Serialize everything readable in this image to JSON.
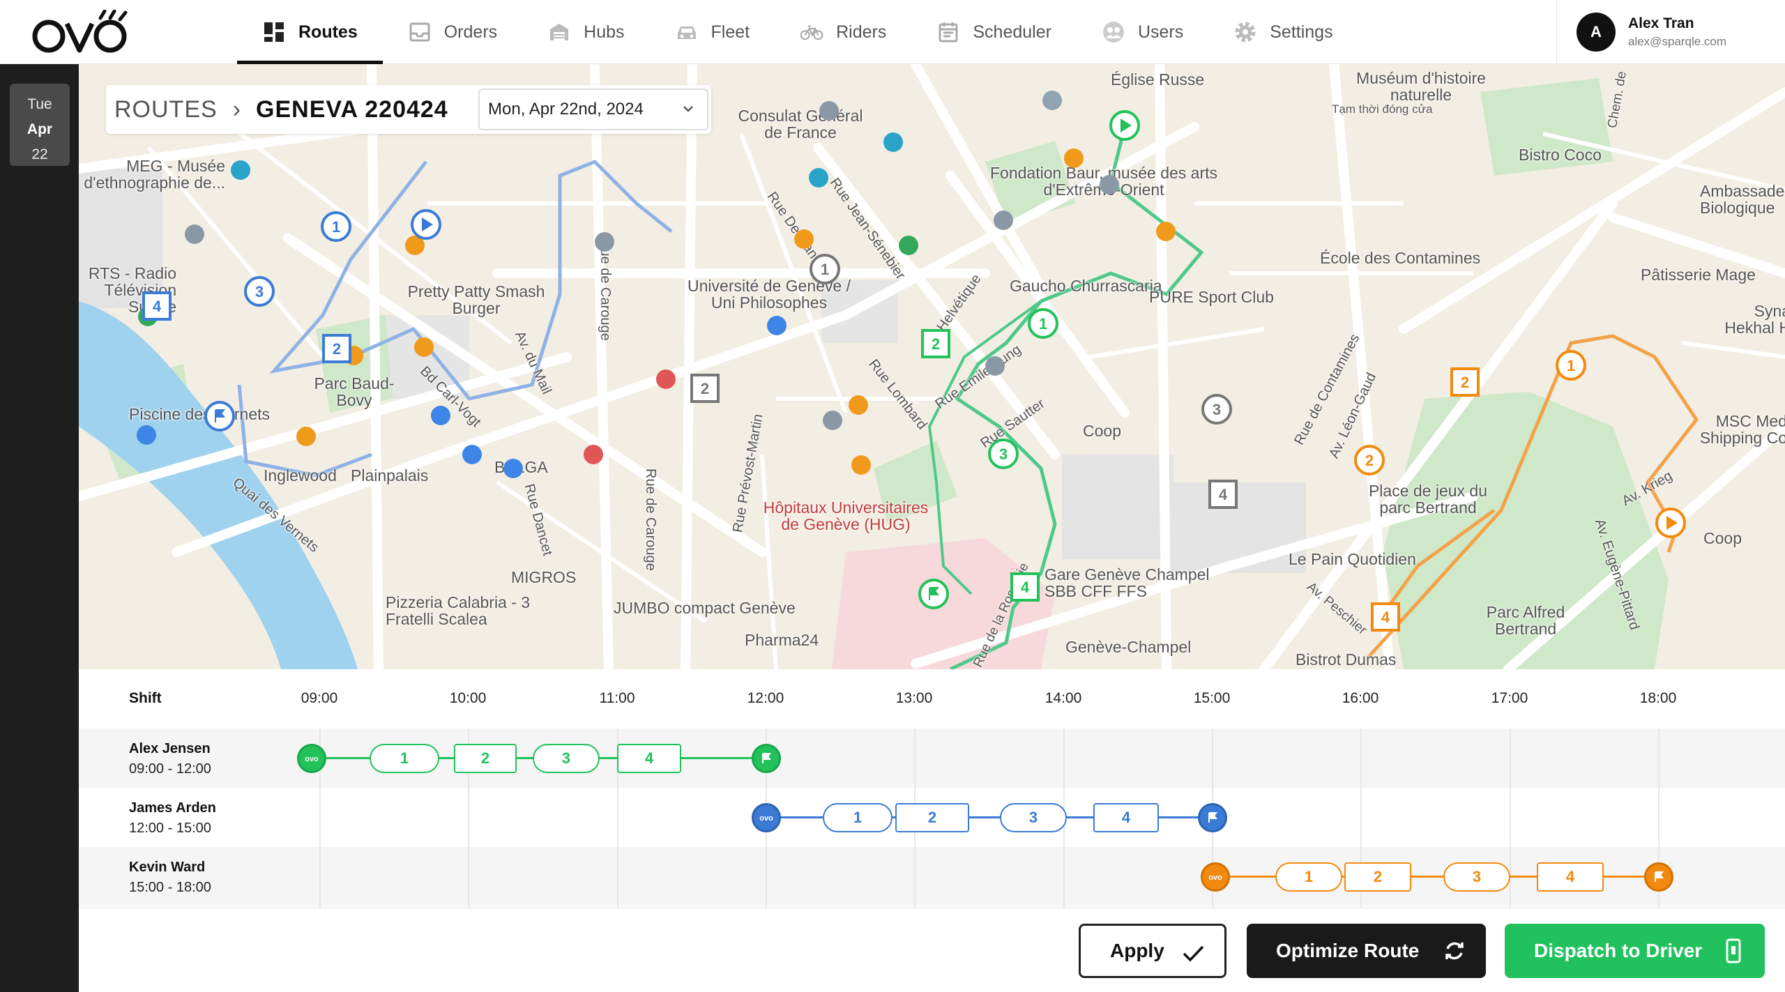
{
  "brand": {
    "logo_text": "ovo"
  },
  "nav": [
    {
      "label": "Routes",
      "icon": "grid-icon",
      "active": true
    },
    {
      "label": "Orders",
      "icon": "inbox-icon"
    },
    {
      "label": "Hubs",
      "icon": "warehouse-icon"
    },
    {
      "label": "Fleet",
      "icon": "car-icon"
    },
    {
      "label": "Riders",
      "icon": "bicycle-icon"
    },
    {
      "label": "Scheduler",
      "icon": "calendar-icon"
    },
    {
      "label": "Users",
      "icon": "users-icon"
    },
    {
      "label": "Settings",
      "icon": "gear-icon"
    }
  ],
  "user": {
    "initial": "A",
    "name": "Alex Tran",
    "email": "alex@sparqle.com"
  },
  "rail": {
    "day": "Tue",
    "month": "Apr",
    "date": "22"
  },
  "breadcrumb": {
    "root": "ROUTES",
    "current": "GENEVA 220424",
    "date_value": "Mon, Apr 22nd, 2024"
  },
  "map_labels": {
    "eglise_russe": "Église Russe",
    "museum": "Muséum d'histoire naturelle",
    "museum_note": "Tạm thời đóng cửa",
    "bistro_coco": "Bistro Coco",
    "ambassade": "Ambassade Biologique",
    "consulat": "Consulat Général de France",
    "meg": "MEG - Musée d'ethnographie de...",
    "fondation": "Fondation Baur, musée des arts d'Extrême-Orient",
    "ecole": "École des Contamines",
    "patisserie": "Pâtisserie Mage",
    "rts": "RTS - Radio Télévision Suisse",
    "pretty_patty": "Pretty Patty Smash Burger",
    "universite": "Université de Genève / Uni Philosophes",
    "gaucho": "Gaucho Churrascaria",
    "pure": "PURE Sport Club",
    "syna": "Syna Hekhal H",
    "parc_baud": "Parc Baud-Bovy",
    "piscine": "Piscine des Vernets",
    "coop1": "Coop",
    "msc": "MSC Med Shipping Co",
    "inglewood": "Inglewood",
    "plainpalais": "Plainpalais",
    "belga": "BELGA",
    "place_jeux": "Place de jeux du parc Bertrand",
    "hug": "Hôpitaux Universitaires de Genève (HUG)",
    "coop2": "Coop",
    "le_pain": "Le Pain Quotidien",
    "migros": "MIGROS",
    "gare": "Gare Genève Champel SBB CFF FFS",
    "pizzeria": "Pizzeria Calabria - 3 Fratelli Scalea",
    "jumbo": "JUMBO compact Genève",
    "parc_alfred": "Parc Alfred Bertrand",
    "pharma": "Pharma24",
    "geneve_champel": "Genève-Champel",
    "bistrot": "Bistrot Dumas",
    "rue_carouge": "Rue de Carouge",
    "rue_carouge2": "Rue de Carouge",
    "bd_carl_vogt": "Bd Carl-Vogt",
    "av_mail": "Av. du Mail",
    "rue_candolle": "Rue De-Candolle",
    "rue_senebier": "Rue Jean-Sénebier",
    "bd_helvetique": "Bd Helvétique",
    "rue_lombard": "Rue Lombard",
    "rue_emile": "Rue Emile-Yung",
    "rue_sautter": "Rue Sautter",
    "rue_contamines": "Rue de Contamines",
    "av_leon": "Av. Léon-Gaud",
    "av_krieg": "Av. Krieg",
    "av_pictet": "Av. Eugène-Pittard",
    "quai_vernets": "Quai des Vernets",
    "rue_dancet": "Rue Dancet",
    "rue_prevost": "Rue Prévost-Martin",
    "rue_roseraie": "Rue de la Roseraie",
    "chem": "Chem. de",
    "av_peschier": "Av. Peschier"
  },
  "schedule": {
    "shift_header": "Shift",
    "ticks": [
      "09:00",
      "10:00",
      "11:00",
      "12:00",
      "13:00",
      "14:00",
      "15:00",
      "16:00",
      "17:00",
      "18:00"
    ],
    "drivers": [
      {
        "name": "Alex Jensen",
        "time": "09:00 - 12:00",
        "color": "#22c25a",
        "stops": [
          "1",
          "2",
          "3",
          "4"
        ]
      },
      {
        "name": "James Arden",
        "time": "12:00 - 15:00",
        "color": "#3b7bd6",
        "stops": [
          "1",
          "2",
          "3",
          "4"
        ]
      },
      {
        "name": "Kevin Ward",
        "time": "15:00 - 18:00",
        "color": "#f28a0f",
        "stops": [
          "1",
          "2",
          "3",
          "4"
        ]
      }
    ]
  },
  "actions": {
    "apply": "Apply",
    "optimize": "Optimize Route",
    "dispatch": "Dispatch to Driver"
  },
  "colors": {
    "green": "#22c25a",
    "blue": "#3b7bd6",
    "orange": "#f28a0f",
    "gray": "#777777",
    "accent_green_btn": "#21c25e"
  }
}
